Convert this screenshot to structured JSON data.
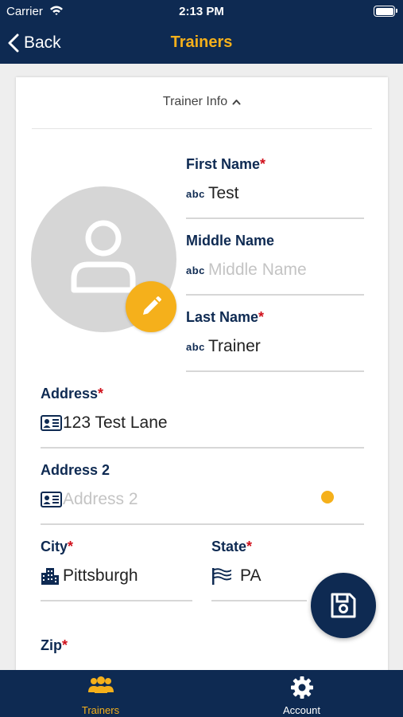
{
  "status_bar": {
    "carrier": "Carrier",
    "time": "2:13 PM"
  },
  "nav": {
    "back_label": "Back",
    "title": "Trainers"
  },
  "section": {
    "title": "Trainer Info"
  },
  "fields": {
    "first_name": {
      "label": "First Name",
      "required": "*",
      "value": "Test",
      "placeholder": "First Name",
      "icon": "abc-icon"
    },
    "middle_name": {
      "label": "Middle Name",
      "value": "",
      "placeholder": "Middle Name",
      "icon": "abc-icon"
    },
    "last_name": {
      "label": "Last Name",
      "required": "*",
      "value": "Trainer",
      "placeholder": "Last Name",
      "icon": "abc-icon"
    },
    "address": {
      "label": "Address",
      "required": "*",
      "value": "123 Test Lane",
      "placeholder": "Address",
      "icon": "id-card-icon"
    },
    "address2": {
      "label": "Address 2",
      "value": "",
      "placeholder": "Address 2",
      "icon": "id-card-icon"
    },
    "city": {
      "label": "City",
      "required": "*",
      "value": "Pittsburgh",
      "placeholder": "City",
      "icon": "buildings-icon"
    },
    "state": {
      "label": "State",
      "required": "*",
      "value": "PA",
      "placeholder": "State",
      "icon": "flag-icon"
    },
    "zip": {
      "label": "Zip",
      "required": "*"
    }
  },
  "tabs": [
    {
      "label": "Trainers",
      "icon": "people-icon",
      "active": true
    },
    {
      "label": "Account",
      "icon": "gear-icon",
      "active": false
    }
  ],
  "colors": {
    "navy": "#0e2a52",
    "accent": "#f5b01b",
    "required": "#d0101b"
  }
}
